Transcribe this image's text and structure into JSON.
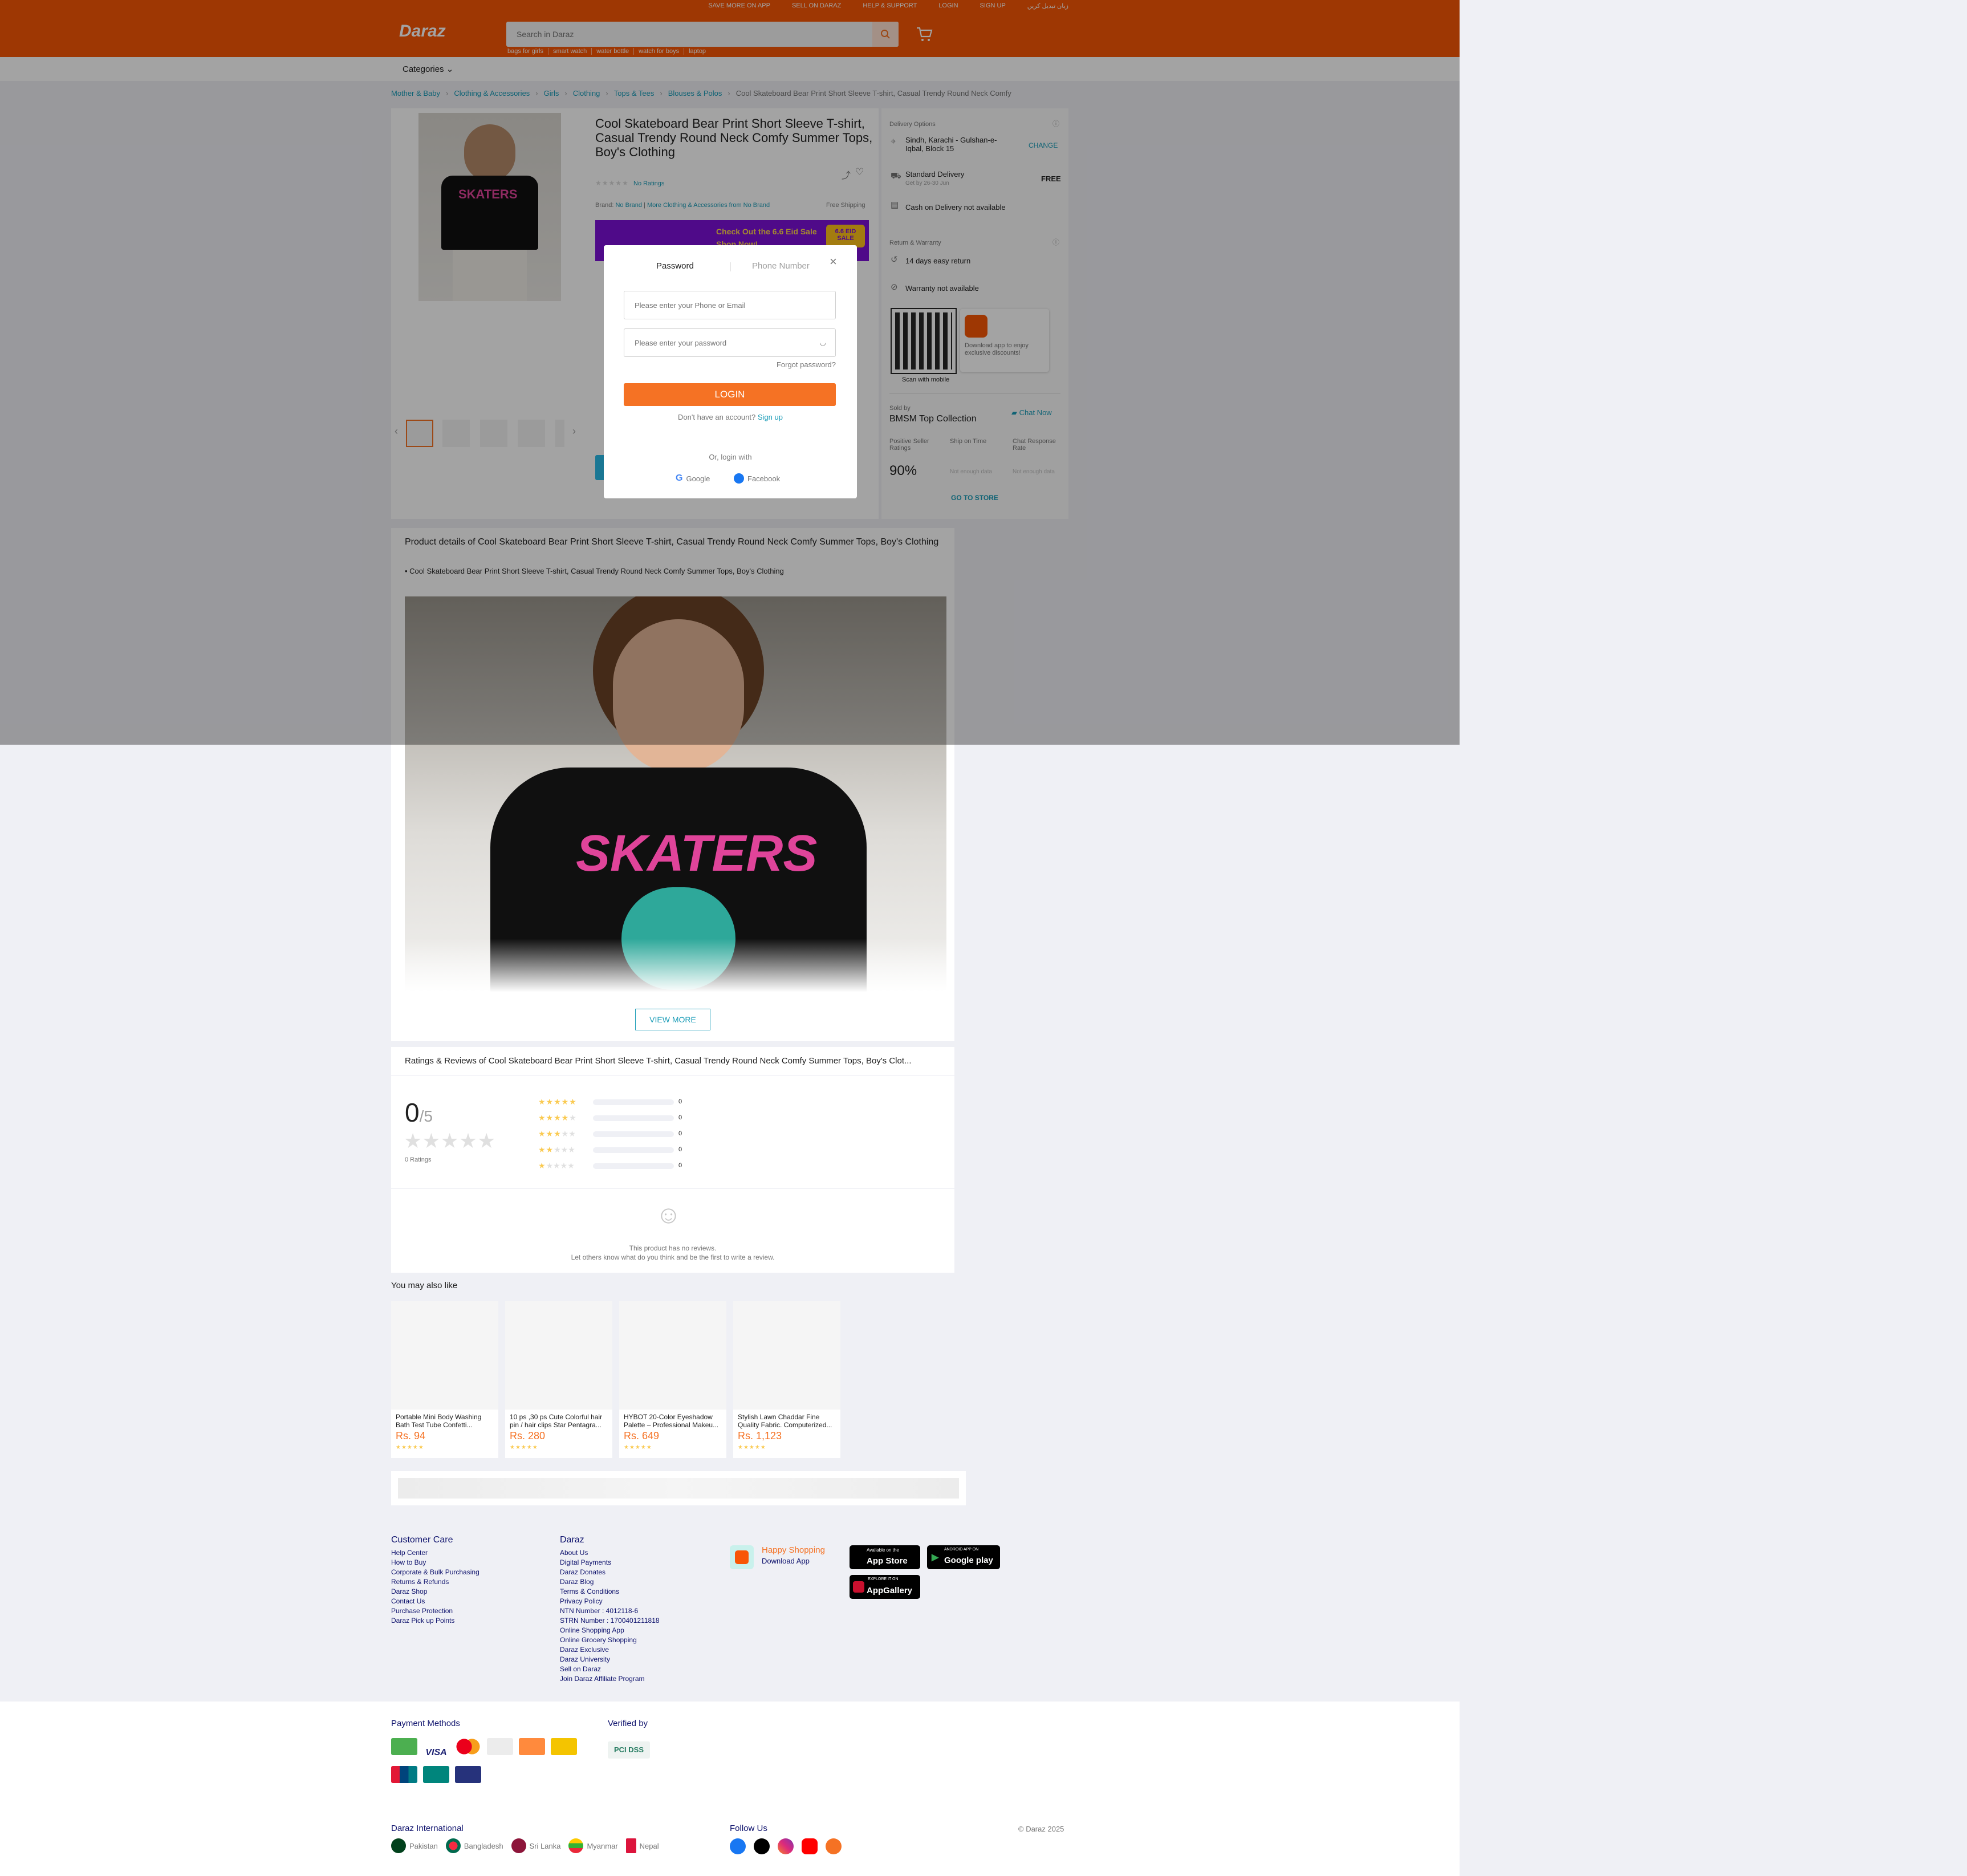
{
  "top_links": [
    "SAVE MORE ON APP",
    "SELL ON DARAZ",
    "HELP & SUPPORT",
    "LOGIN",
    "SIGN UP",
    "زبان تبدیل کریں"
  ],
  "logo": "Daraz",
  "search": {
    "placeholder": "Search in Daraz",
    "hints": [
      "bags for girls",
      "smart watch",
      "water bottle",
      "watch for boys",
      "laptop"
    ]
  },
  "categories_label": "Categories",
  "breadcrumbs": [
    "Mother & Baby",
    "Clothing & Accessories",
    "Girls",
    "Clothing",
    "Tops & Tees",
    "Blouses & Polos",
    "Cool Skateboard Bear Print Short Sleeve T-shirt, Casual Trendy Round Neck Comfy"
  ],
  "product": {
    "title": "Cool Skateboard Bear Print Short Sleeve T-shirt, Casual Trendy Round Neck Comfy Summer Tops, Boy's Clothing",
    "ratings_link": "No Ratings",
    "brand_label": "Brand:",
    "brand": "No Brand",
    "more_from": "More Clothing & Accessories from No Brand",
    "free_shipping": "Free Shipping",
    "banner_text": "Check Out the 6.6 Eid Sale",
    "banner_sub": "Shop Now!",
    "banner_badge": "6.6 EID SALE"
  },
  "delivery": {
    "title": "Delivery Options",
    "location": "Sindh, Karachi - Gulshan-e-Iqbal, Block 15",
    "change": "CHANGE",
    "standard": "Standard Delivery",
    "standard_date": "Get by 26-30 Jun",
    "standard_price": "FREE",
    "cod": "Cash on Delivery not available",
    "return_title": "Return & Warranty",
    "return": "14 days easy return",
    "warranty": "Warranty not available",
    "app_promo": "Download app to enjoy exclusive discounts!",
    "scan": "Scan with mobile"
  },
  "seller": {
    "sold_by": "Sold by",
    "name": "BMSM Top Collection",
    "chat": "Chat Now",
    "metrics": [
      {
        "label": "Positive Seller Ratings",
        "value": "90%"
      },
      {
        "label": "Ship on Time",
        "value": "Not enough data"
      },
      {
        "label": "Chat Response Rate",
        "value": "Not enough data"
      }
    ],
    "go_store": "GO TO STORE"
  },
  "login_modal": {
    "tab_password": "Password",
    "tab_phone": "Phone Number",
    "phone_placeholder": "Please enter your Phone or Email",
    "password_placeholder": "Please enter your password",
    "forgot": "Forgot password?",
    "login": "LOGIN",
    "no_account": "Don't have an account?",
    "signup": "Sign up",
    "or": "Or, login with",
    "google": "Google",
    "facebook": "Facebook"
  },
  "details": {
    "title": "Product details of Cool Skateboard Bear Print Short Sleeve T-shirt, Casual Trendy Round Neck Comfy Summer Tops, Boy's Clothing",
    "bullet": "Cool Skateboard Bear Print Short Sleeve T-shirt, Casual Trendy Round Neck Comfy Summer Tops, Boy's Clothing",
    "shirt_text": "SKATERS",
    "view_more": "VIEW MORE"
  },
  "reviews": {
    "title": "Ratings & Reviews of Cool Skateboard Bear Print Short Sleeve T-shirt, Casual Trendy Round Neck Comfy Summer Tops, Boy's Clot...",
    "score": "0",
    "out_of": "/5",
    "count": "0 Ratings",
    "bars": [
      {
        "stars": 5,
        "count": "0"
      },
      {
        "stars": 4,
        "count": "0"
      },
      {
        "stars": 3,
        "count": "0"
      },
      {
        "stars": 2,
        "count": "0"
      },
      {
        "stars": 1,
        "count": "0"
      }
    ],
    "empty1": "This product has no reviews.",
    "empty2": "Let others know what do you think and be the first to write a review."
  },
  "also_like": {
    "title": "You may also like",
    "items": [
      {
        "title": "Portable Mini Body Washing Bath Test Tube Confetti...",
        "price": "Rs. 94"
      },
      {
        "title": "10 ps ,30 ps Cute Colorful hair pin / hair clips Star Pentagra...",
        "price": "Rs. 280"
      },
      {
        "title": "HYBOT 20-Color Eyeshadow Palette – Professional Makeu...",
        "price": "Rs. 649"
      },
      {
        "title": "Stylish Lawn Chaddar Fine Quality Fabric. Computerized...",
        "price": "Rs. 1,123"
      }
    ]
  },
  "footer": {
    "customer_care": {
      "title": "Customer Care",
      "links": [
        "Help Center",
        "How to Buy",
        "Corporate & Bulk Purchasing",
        "Returns & Refunds",
        "Daraz Shop",
        "Contact Us",
        "Purchase Protection",
        "Daraz Pick up Points"
      ]
    },
    "daraz": {
      "title": "Daraz",
      "links": [
        "About Us",
        "Digital Payments",
        "Daraz Donates",
        "Daraz Blog",
        "Terms & Conditions",
        "Privacy Policy",
        "NTN Number : 4012118-6",
        "STRN Number : 1700401211818",
        "Online Shopping App",
        "Online Grocery Shopping",
        "Daraz Exclusive",
        "Daraz University",
        "Sell on Daraz",
        "Join Daraz Affiliate Program"
      ]
    },
    "happy": "Happy Shopping",
    "download": "Download App",
    "app_store": "App Store",
    "app_store_top": "Available on the",
    "google_play": "Google play",
    "google_play_top": "ANDROID APP ON",
    "app_gallery": "AppGallery",
    "app_gallery_top": "EXPLORE IT ON",
    "payment": "Payment Methods",
    "verified": "Verified by",
    "international": "Daraz International",
    "countries": [
      "Pakistan",
      "Bangladesh",
      "Sri Lanka",
      "Myanmar",
      "Nepal"
    ],
    "follow": "Follow Us",
    "copyright": "© Daraz 2025"
  },
  "colors": {
    "brand": "#f85606",
    "accent": "#f57224",
    "link": "#1a9cb7",
    "star": "#faca51"
  }
}
